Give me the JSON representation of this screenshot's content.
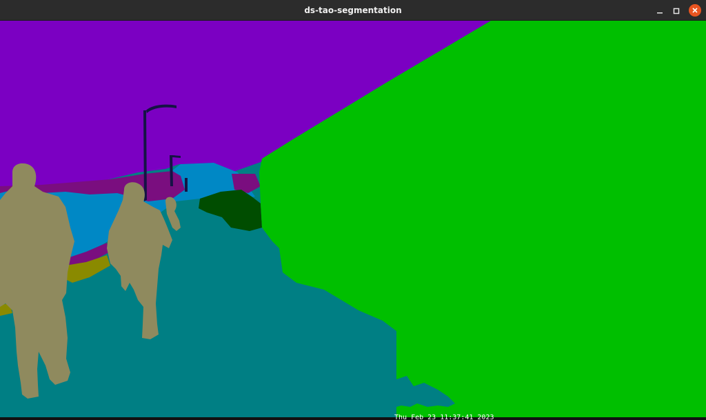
{
  "window": {
    "title": "ds-tao-segmentation"
  },
  "controls": {
    "minimize_icon": "minimize-icon",
    "maximize_icon": "maximize-icon",
    "close_icon": "close-icon"
  },
  "segmentation": {
    "colors": {
      "sky": "#7b00c2",
      "building": "#00bf00",
      "road": "#007f84",
      "person": "#8f8a5e",
      "water": "#0088c5",
      "terrain": "#7a0e7f",
      "pole": "#151345",
      "vegetation": "#004d00",
      "sidewalk": "#8a8a00"
    }
  },
  "overlay": {
    "text": "Thu Feb 23 11:37:41 2023"
  }
}
